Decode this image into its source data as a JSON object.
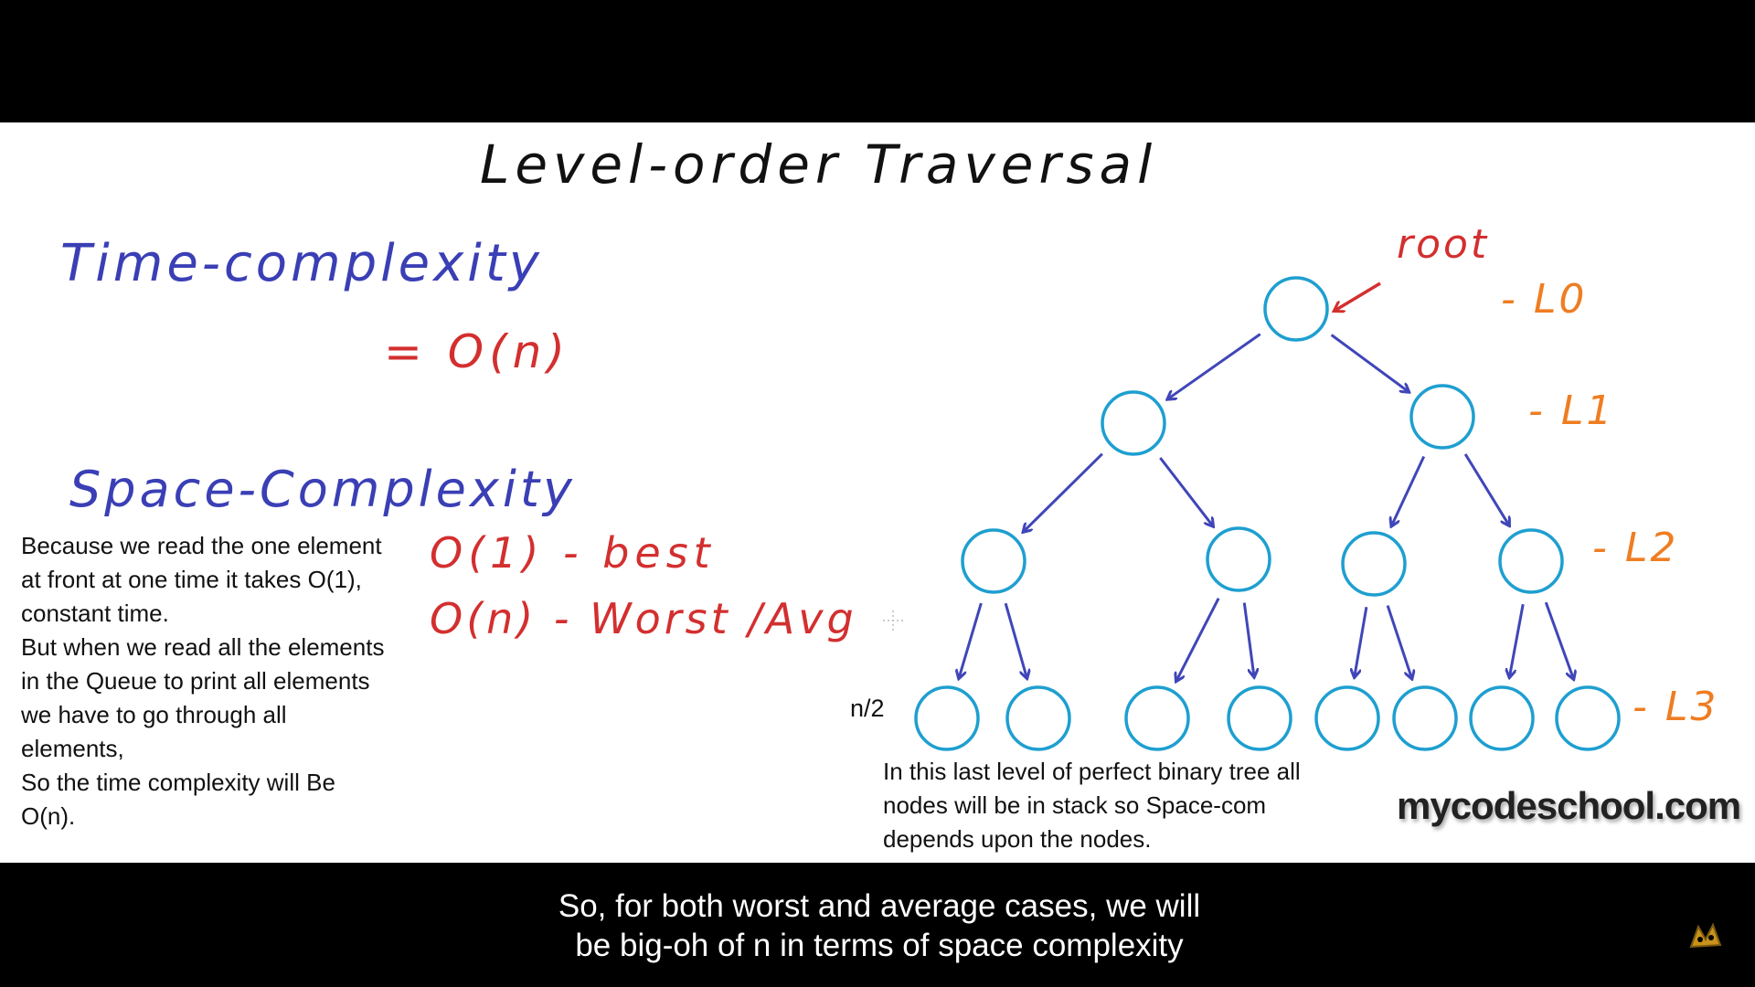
{
  "slide": {
    "title": "Level-order Traversal",
    "time_label": "Time-complexity",
    "time_value": "= O(n)",
    "space_label": "Space-Complexity",
    "best": "O(1) - best",
    "worst": "O(n) - Worst /Avg",
    "note_left": "Because we read the one element at front at one time it takes O(1), constant time.\nBut when we read all the elements in the Queue to print all elements we have to go through all elements,\nSo the time complexity will Be O(n).",
    "note_right": "In this last level of perfect binary tree all nodes will be in stack so Space-com depends upon the nodes.",
    "n_half": "n/2",
    "watermark": "mycodeschool.com",
    "root_label": "root",
    "levels": [
      "- L0",
      "- L1",
      "- L2",
      "- L3"
    ]
  },
  "caption": {
    "line1": "So, for both worst and average cases, we will",
    "line2": "be big-oh of n in terms of space complexity"
  },
  "colors": {
    "node": "#1e9fd0",
    "edge": "#4046b8",
    "root_arrow": "#d32f2f",
    "level_label": "#ef7d22",
    "heading": "#3a3fb5",
    "formula": "#d32f2f"
  },
  "icons": [
    "cursor-crosshair-icon",
    "channel-logo-icon"
  ]
}
